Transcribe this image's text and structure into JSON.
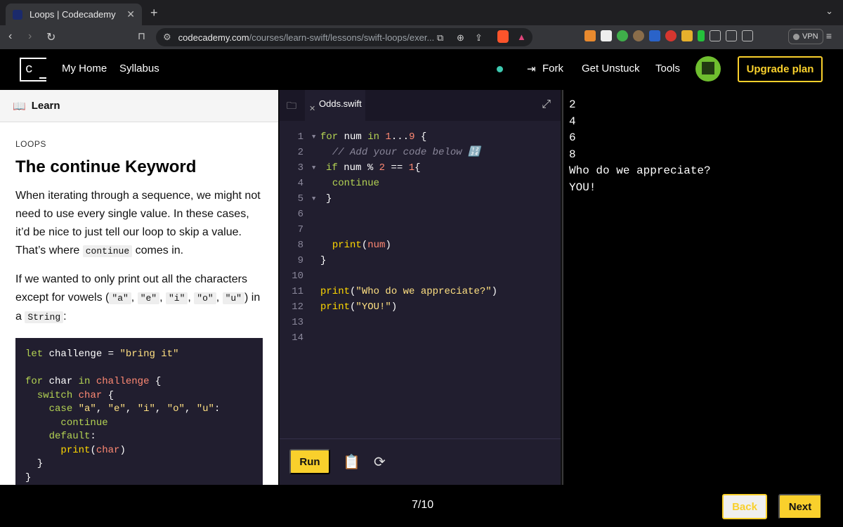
{
  "browser": {
    "tab_title": "Loops | Codecademy",
    "url_host": "codecademy.com",
    "url_path": "/courses/learn-swift/lessons/swift-loops/exer...",
    "vpn_label": "VPN"
  },
  "header": {
    "my_home": "My Home",
    "syllabus": "Syllabus",
    "fork": "Fork",
    "get_unstuck": "Get Unstuck",
    "tools": "Tools",
    "upgrade": "Upgrade plan",
    "accent": "#f9d02c"
  },
  "learn": {
    "panel_label": "Learn",
    "kicker": "LOOPS",
    "title": "The continue Keyword",
    "p1_a": "When iterating through a sequence, we might not need to use every single value. In these cases, it’d be nice to just tell our loop to skip a value. That’s where ",
    "p1_code": "continue",
    "p1_b": " comes in.",
    "p2_a": "If we wanted to only print out all the characters except for vowels (",
    "p2_a_code": "\"a\"",
    "p2_sep": ", ",
    "p2_e_code": "\"e\"",
    "p2_i_code": "\"i\"",
    "p2_o_code": "\"o\"",
    "p2_u_code": "\"u\"",
    "p2_b": ") in a ",
    "p2_string_code": "String",
    "p2_c": ":"
  },
  "editor": {
    "file_tab": "Odds.swift",
    "run_label": "Run",
    "lines": [
      "1",
      "2",
      "3",
      "4",
      "5",
      "6",
      "7",
      "8",
      "9",
      "10",
      "11",
      "12",
      "13",
      "14"
    ]
  },
  "output": {
    "lines": [
      "2",
      "4",
      "6",
      "8",
      "Who do we appreciate?",
      "YOU!"
    ]
  },
  "footer": {
    "progress": "7/10",
    "back": "Back",
    "next": "Next"
  }
}
